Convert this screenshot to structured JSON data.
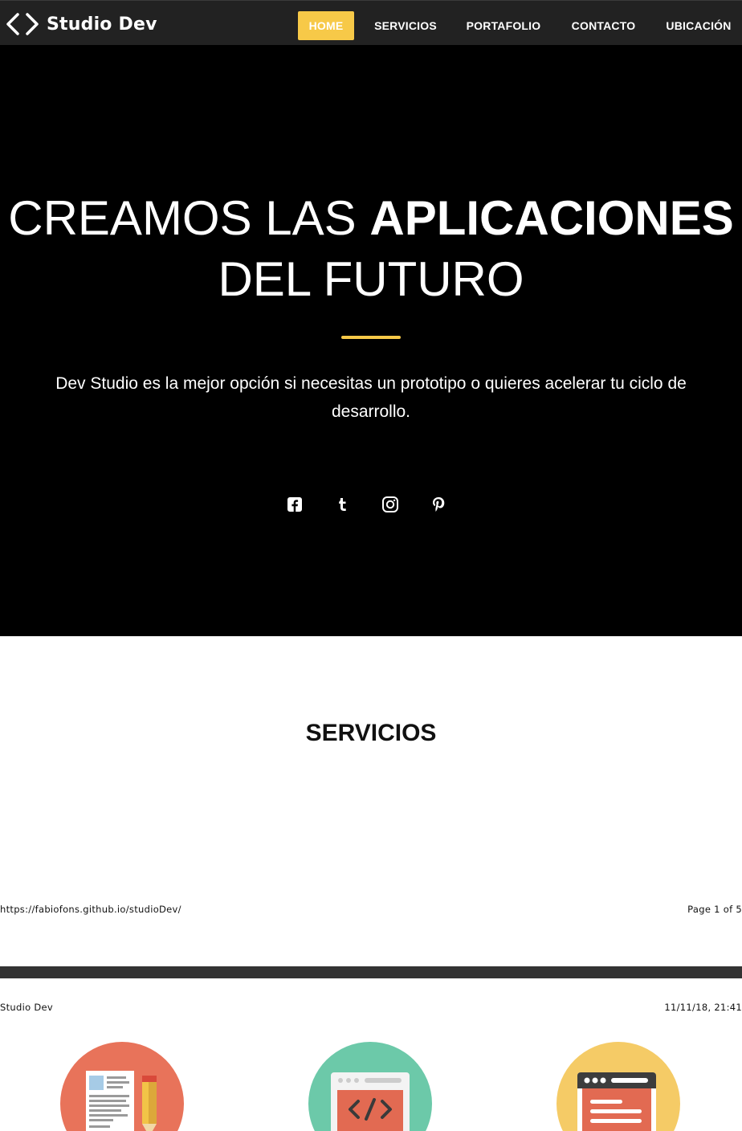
{
  "navbar": {
    "brand": "Studio Dev",
    "logo_icon": "code-brackets-icon",
    "items": [
      {
        "label": "HOME",
        "active": true
      },
      {
        "label": "SERVICIOS",
        "active": false
      },
      {
        "label": "PORTAFOLIO",
        "active": false
      },
      {
        "label": "CONTACTO",
        "active": false
      },
      {
        "label": "UBICACIÓN",
        "active": false
      }
    ]
  },
  "hero": {
    "title_part1": "CREAMOS LAS",
    "title_bold": "APLICACIONES",
    "title_part2": "DEL FUTURO",
    "subtitle": "Dev Studio es la mejor opción si necesitas un prototipo o quieres acelerar tu ciclo de desarrollo.",
    "social_icons": [
      "facebook-icon",
      "tumblr-icon",
      "instagram-icon",
      "pinterest-icon"
    ]
  },
  "services": {
    "title": "SERVICIOS",
    "icons": [
      "document-pencil-icon",
      "code-window-icon",
      "browser-window-icon"
    ]
  },
  "print": {
    "url": "https://fabiofons.github.io/studioDev/",
    "page": "Page 1 of 5",
    "site_title": "Studio Dev",
    "datetime": "11/11/18, 21:41"
  },
  "colors": {
    "accent": "#f7c948",
    "navbar": "#222222",
    "hero_bg": "#000000",
    "icon_orange": "#e8735a",
    "icon_teal": "#6cc9a9",
    "icon_yellow": "#f5cb66"
  }
}
